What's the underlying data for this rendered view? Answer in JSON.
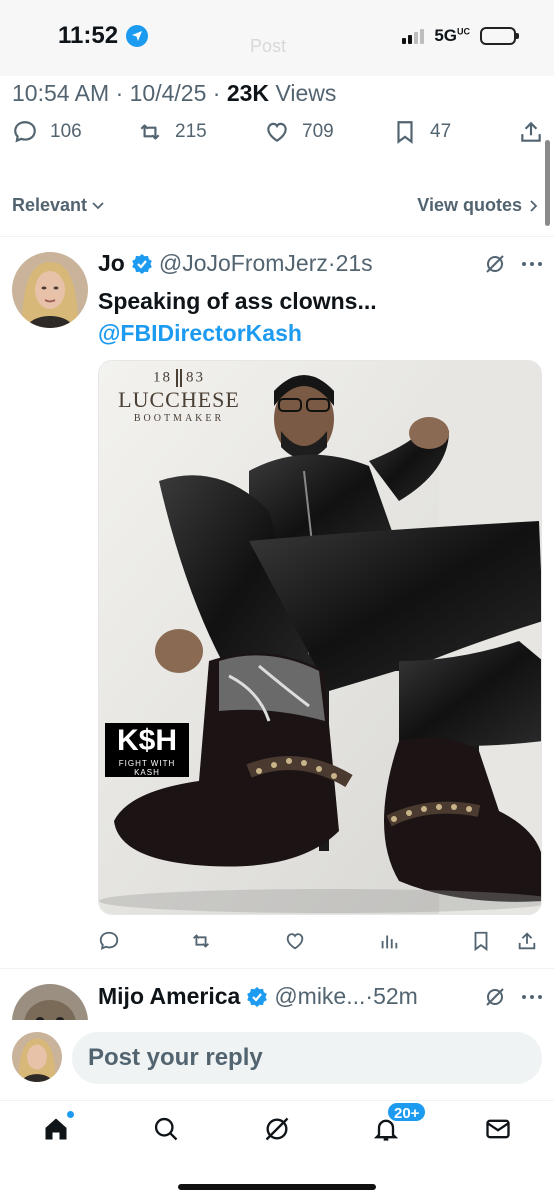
{
  "status_bar": {
    "time": "11:52",
    "network": "5G",
    "network_suffix": "UC",
    "faded_title": "Post"
  },
  "post_meta": {
    "time": "10:54 AM",
    "date": "10/4/25",
    "views_count": "23K",
    "views_label": "Views",
    "separator": "·"
  },
  "post_actions": {
    "replies": "106",
    "reposts": "215",
    "likes": "709",
    "bookmarks": "47"
  },
  "sort": {
    "label": "Relevant",
    "view_quotes": "View quotes"
  },
  "reply": {
    "name": "Jo",
    "handle": "@JoJoFromJerz",
    "separator": "·",
    "age": "21s",
    "text": "Speaking of ass clowns...",
    "mention": "@FBIDirectorKash",
    "media": {
      "logo_year_left": "18",
      "logo_year_right": "83",
      "logo_brand": "LUCCHESE",
      "logo_sub": "BOOTMAKER",
      "stamp_title": "K$H",
      "stamp_sub": "FIGHT WITH KASH"
    }
  },
  "reply2": {
    "name": "Mijo America",
    "handle": "@mike...",
    "separator": "·",
    "age": "52m"
  },
  "composer": {
    "placeholder": "Post your reply"
  },
  "tabbar": {
    "notification_badge": "20+"
  },
  "colors": {
    "accent": "#1d9bf0",
    "secondary_text": "#536471",
    "primary_text": "#0f1419"
  }
}
